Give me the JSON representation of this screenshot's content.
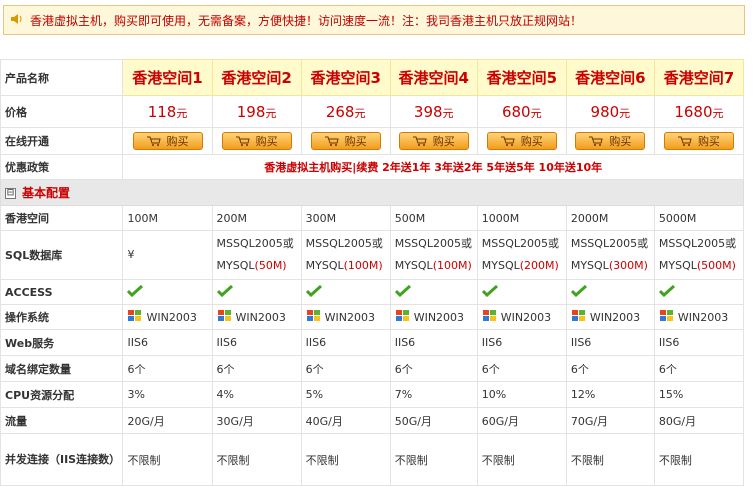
{
  "notice": {
    "text": "香港虚拟主机，购买即可使用，无需备案，方便快捷！访问速度一流！注：我司香港主机只放正规网站！",
    "icon": "speaker-icon"
  },
  "row_labels": {
    "name": "产品名称",
    "price": "价格",
    "buy": "在线开通",
    "promo": "优惠政策",
    "space": "香港空间",
    "sql": "SQL数据库",
    "access": "ACCESS",
    "os": "操作系统",
    "web": "Web服务",
    "domains": "域名绑定数量",
    "cpu": "CPU资源分配",
    "traffic": "流量",
    "conn": "并发连接（IIS连接数）"
  },
  "buy_label": "购买",
  "promo_text": "香港虚拟主机购买|续费 2年送1年 3年送2年 5年送5年 10年送10年",
  "section": {
    "title": "基本配置",
    "toggle": "⊟"
  },
  "sql_prefix": "MSSQL2005或",
  "mysql_prefix": "MYSQL",
  "price_unit": "元",
  "products": [
    {
      "name": "香港空间1",
      "price": "118",
      "space": "100M",
      "sql": "¥",
      "mysql": "",
      "os": "WIN2003",
      "web": "IIS6",
      "domains": "6个",
      "cpu": "3%",
      "traffic": "20G/月",
      "conn": "不限制"
    },
    {
      "name": "香港空间2",
      "price": "198",
      "space": "200M",
      "sql": "MSSQL2005或",
      "mysql": "(50M)",
      "os": "WIN2003",
      "web": "IIS6",
      "domains": "6个",
      "cpu": "4%",
      "traffic": "30G/月",
      "conn": "不限制"
    },
    {
      "name": "香港空间3",
      "price": "268",
      "space": "300M",
      "sql": "MSSQL2005或",
      "mysql": "(100M)",
      "os": "WIN2003",
      "web": "IIS6",
      "domains": "6个",
      "cpu": "5%",
      "traffic": "40G/月",
      "conn": "不限制"
    },
    {
      "name": "香港空间4",
      "price": "398",
      "space": "500M",
      "sql": "MSSQL2005或",
      "mysql": "(100M)",
      "os": "WIN2003",
      "web": "IIS6",
      "domains": "6个",
      "cpu": "7%",
      "traffic": "50G/月",
      "conn": "不限制"
    },
    {
      "name": "香港空间5",
      "price": "680",
      "space": "1000M",
      "sql": "MSSQL2005或",
      "mysql": "(200M)",
      "os": "WIN2003",
      "web": "IIS6",
      "domains": "6个",
      "cpu": "10%",
      "traffic": "60G/月",
      "conn": "不限制"
    },
    {
      "name": "香港空间6",
      "price": "980",
      "space": "2000M",
      "sql": "MSSQL2005或",
      "mysql": "(300M)",
      "os": "WIN2003",
      "web": "IIS6",
      "domains": "6个",
      "cpu": "12%",
      "traffic": "70G/月",
      "conn": "不限制"
    },
    {
      "name": "香港空间7",
      "price": "1680",
      "space": "5000M",
      "sql": "MSSQL2005或",
      "mysql": "(500M)",
      "os": "WIN2003",
      "web": "IIS6",
      "domains": "6个",
      "cpu": "15%",
      "traffic": "80G/月",
      "conn": "不限制"
    }
  ],
  "colors": {
    "accent": "#cc0000",
    "notice_bg": "#fff7d9",
    "name_bg": "#fffbcc",
    "button": "#f29d1c"
  }
}
